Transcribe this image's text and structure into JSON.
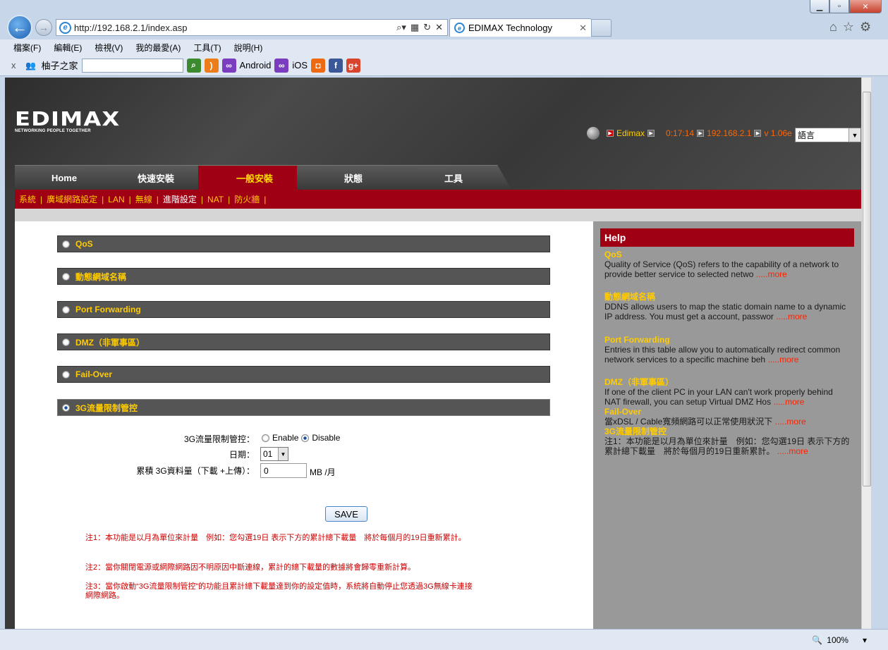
{
  "browser": {
    "url": "http://192.168.2.1/index.asp",
    "tab_title": "EDIMAX Technology",
    "menu": [
      "檔案(F)",
      "編輯(E)",
      "檢視(V)",
      "我的最愛(A)",
      "工具(T)",
      "說明(H)"
    ],
    "toolbar": {
      "close": "x",
      "site": "柚子之家",
      "android": "Android",
      "ios": "iOS"
    },
    "zoom": "100%"
  },
  "router": {
    "logo": "EDIMAX",
    "logo_sub": "NETWORKING PEOPLE TOGETHER",
    "status": {
      "name": "Edimax",
      "time": "0:17:14",
      "ip": "192.168.2.1",
      "version": "v 1.06e"
    },
    "language": "語言",
    "main_tabs": [
      "Home",
      "快速安裝",
      "一般安裝",
      "狀態",
      "工具"
    ],
    "sub_nav": [
      "系統",
      "廣域網路設定",
      "LAN",
      "無線",
      "進階設定",
      "NAT",
      "防火牆"
    ],
    "sections": [
      "QoS",
      "動態網域名稱",
      "Port Forwarding",
      "DMZ（非軍事區）",
      "Fail-Over",
      "3G流量限制管控"
    ],
    "form": {
      "limit_label": "3G流量限制管控：",
      "enable": "Enable",
      "disable": "Disable",
      "date_label": "日期：",
      "date_value": "01",
      "usage_label": "累積 3G資料量（下載 +上傳）：",
      "usage_value": "0",
      "usage_unit": "MB /月",
      "save": "SAVE"
    },
    "notes": [
      "注1：本功能是以月為單位來計量　例如：您勾選19日 表示下方的累計總下載量　將於每個月的19日重新累計。",
      "注2：當你關閉電源或網際網路因不明原因中斷連線，累計的總下載量的數據將會歸零重新計算。",
      "注3：當你啟動“3G流量限制管控”的功能且累計總下載量達到你的設定值時，系統將自動停止您透過3G無線卡連接網際網路。"
    ],
    "help": {
      "title": "Help",
      "items": [
        {
          "title": "QoS",
          "text": "Quality of Service (QoS) refers to the capability of a network to provide better service to selected netwo",
          "more": ".....more"
        },
        {
          "title": "動態網域名稱",
          "text": "DDNS allows users to map the static domain name to a dynamic IP address. You must get a account, passwor",
          "more": ".....more"
        },
        {
          "title": "Port Forwarding",
          "text": "Entries in this table allow you to automatically redirect common network services to a specific machine beh",
          "more": ".....more"
        },
        {
          "title": "DMZ（非軍事區）",
          "text": "If one of the client PC in your LAN can't work properly behind NAT firewall, you can setup Virtual DMZ Hos",
          "more": ".....more"
        },
        {
          "title": "Fail-Over",
          "text": "當xDSL / Cable寬頻網路可以正常使用狀況下",
          "more": ".....more"
        },
        {
          "title": "3G流量限制管控",
          "text": "注1：本功能是以月為單位來計量　例如：您勾選19日 表示下方的累計總下載量　將於每個月的19日重新累計。",
          "more": ".....more"
        }
      ]
    }
  }
}
